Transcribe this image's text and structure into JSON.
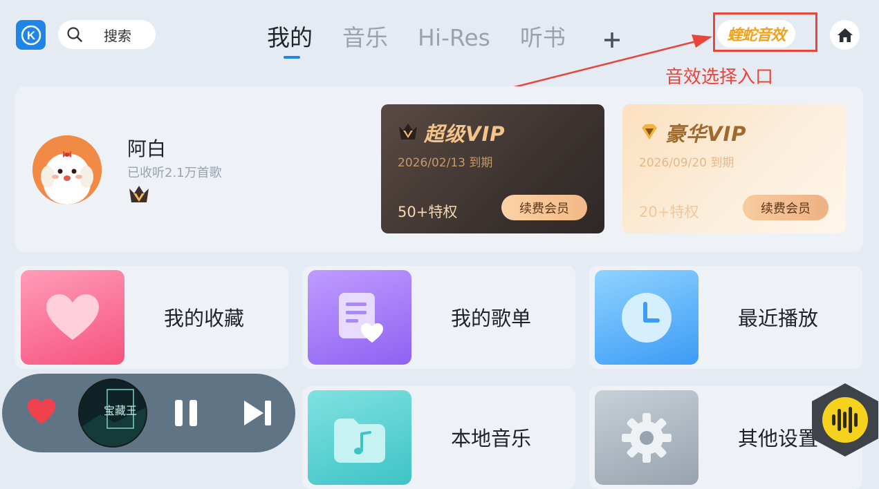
{
  "header": {
    "app_logo_letter": "K",
    "search_label": "搜索",
    "tabs": [
      {
        "label": "我的",
        "active": true
      },
      {
        "label": "音乐",
        "active": false
      },
      {
        "label": "Hi-Res",
        "active": false
      },
      {
        "label": "听书",
        "active": false
      }
    ],
    "add_tab_icon": "plus-icon",
    "sound_effects_label": "蝰蛇音效",
    "home_icon": "home-icon",
    "annotation": "音效选择入口"
  },
  "profile": {
    "name": "阿白",
    "listened": "已收听2.1万首歌",
    "badge_icon": "crown-icon"
  },
  "vip_cards": [
    {
      "title": "超级VIP",
      "expire": "2026/02/13 到期",
      "perks": "50+特权",
      "button": "续费会员"
    },
    {
      "title": "豪华VIP",
      "expire": "2026/09/20 到期",
      "perks": "20+特权",
      "button": "续费会员"
    }
  ],
  "shortcuts": [
    {
      "label": "我的收藏",
      "icon": "heart-icon"
    },
    {
      "label": "我的歌单",
      "icon": "playlist-icon"
    },
    {
      "label": "最近播放",
      "icon": "clock-icon"
    },
    {
      "label": "本地音乐",
      "icon": "folder-music-icon"
    },
    {
      "label": "其他设置",
      "icon": "gear-icon"
    }
  ],
  "player": {
    "cover_text": "宝藏王",
    "state": "playing"
  },
  "colors": {
    "accent": "#1f86e8",
    "annotation_red": "#e8453b",
    "background": "#e4ebf2"
  }
}
